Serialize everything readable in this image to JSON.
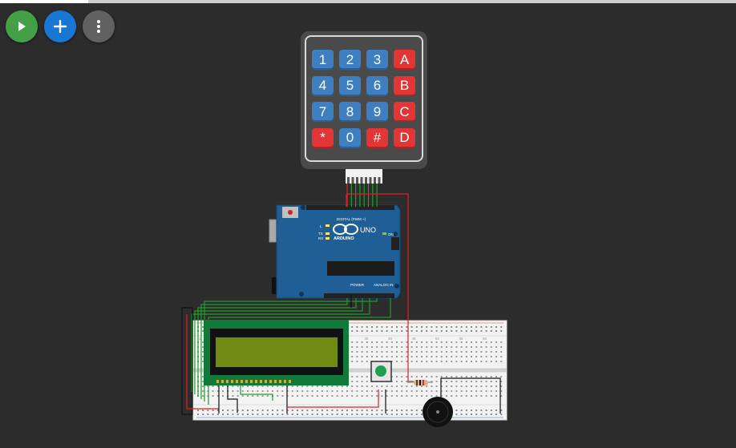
{
  "toolbar": {
    "run": {
      "icon": "play-icon",
      "color": "#43a047"
    },
    "add": {
      "icon": "plus-icon",
      "color": "#1976d2"
    },
    "menu": {
      "icon": "more-vertical-icon",
      "color": "#616161"
    }
  },
  "keypad": {
    "rows": [
      [
        {
          "label": "1",
          "type": "num"
        },
        {
          "label": "2",
          "type": "num"
        },
        {
          "label": "3",
          "type": "num"
        },
        {
          "label": "A",
          "type": "fn"
        }
      ],
      [
        {
          "label": "4",
          "type": "num"
        },
        {
          "label": "5",
          "type": "num"
        },
        {
          "label": "6",
          "type": "num"
        },
        {
          "label": "B",
          "type": "fn"
        }
      ],
      [
        {
          "label": "7",
          "type": "num"
        },
        {
          "label": "8",
          "type": "num"
        },
        {
          "label": "9",
          "type": "num"
        },
        {
          "label": "C",
          "type": "fn"
        }
      ],
      [
        {
          "label": "*",
          "type": "fn"
        },
        {
          "label": "0",
          "type": "num"
        },
        {
          "label": "#",
          "type": "fn"
        },
        {
          "label": "D",
          "type": "fn"
        }
      ]
    ],
    "num_color": "#3d7fc1",
    "fn_color": "#e33535"
  },
  "arduino": {
    "logo_text": "ARDUINO",
    "model": "UNO",
    "digital_label": "DIGITAL (PWM ~)",
    "power_label": "POWER",
    "analog_label": "ANALOG IN",
    "on_label": "ON",
    "tx_label": "TX",
    "rx_label": "RX",
    "l_label": "L",
    "board_color": "#1f5f96"
  },
  "breadboard": {
    "column_numbers": [
      "1",
      "5",
      "10",
      "15",
      "20",
      "25",
      "30",
      "35",
      "40",
      "45",
      "50",
      "55",
      "60"
    ]
  },
  "lcd": {
    "screen_color": "#6f8b12",
    "pcb_color": "#0f7a3a"
  },
  "pushbutton": {
    "cap_color": "#1ea050"
  },
  "buzzer": {
    "color": "#111111"
  },
  "wire_colors": {
    "red": "#e02020",
    "green": "#1f9c2a",
    "black": "#111111"
  }
}
